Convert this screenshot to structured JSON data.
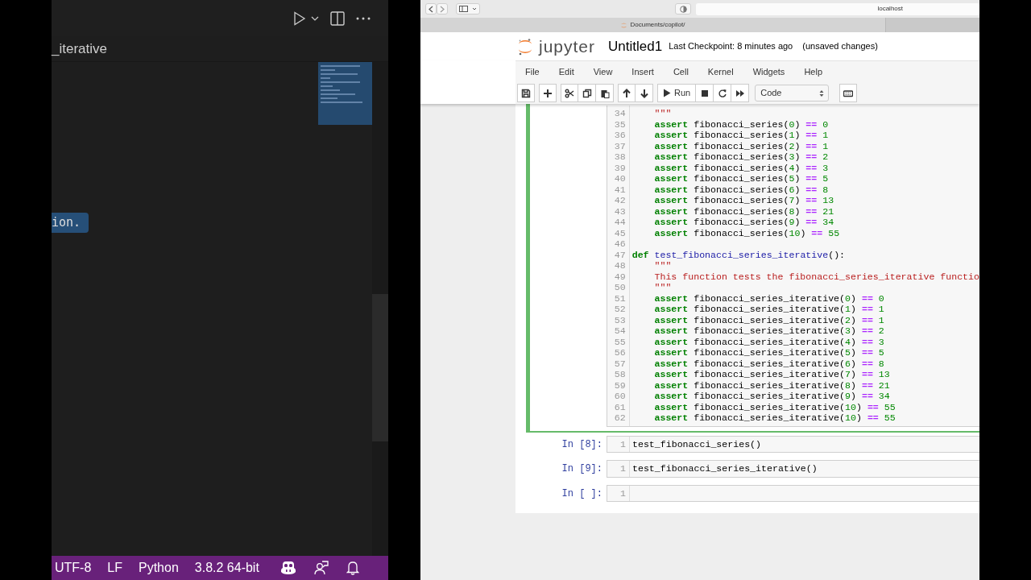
{
  "vscode": {
    "breadcrumb": "_iterative",
    "highlight": "ion.",
    "status_bar": [
      "UTF-8",
      "LF",
      "Python",
      "3.8.2 64-bit"
    ]
  },
  "browser": {
    "address": "localhost",
    "tab": "Documents/copilot/"
  },
  "jupyter": {
    "logo_text": "jupyter",
    "title": "Untitled1",
    "checkpoint": "Last Checkpoint: 8 minutes ago",
    "save_state": "(unsaved changes)",
    "menu": [
      "File",
      "Edit",
      "View",
      "Insert",
      "Cell",
      "Kernel",
      "Widgets",
      "Help"
    ],
    "toolbar": {
      "run_label": "Run",
      "cell_type": "Code"
    },
    "cells": [
      {
        "selected": true,
        "lines": [
          {
            "n": "34",
            "indent": true,
            "tokens": [
              {
                "kind": "string",
                "text": "\"\"\""
              }
            ]
          },
          {
            "n": "35",
            "indent": true,
            "tokens": [
              {
                "kind": "keyword",
                "text": "assert"
              },
              {
                "kind": "plain",
                "text": " fibonacci_series("
              },
              {
                "kind": "number",
                "text": "0"
              },
              {
                "kind": "plain",
                "text": ") "
              },
              {
                "kind": "operator",
                "text": "=="
              },
              {
                "kind": "number",
                "text": " 0"
              }
            ]
          },
          {
            "n": "36",
            "indent": true,
            "tokens": [
              {
                "kind": "keyword",
                "text": "assert"
              },
              {
                "kind": "plain",
                "text": " fibonacci_series("
              },
              {
                "kind": "number",
                "text": "1"
              },
              {
                "kind": "plain",
                "text": ") "
              },
              {
                "kind": "operator",
                "text": "=="
              },
              {
                "kind": "number",
                "text": " 1"
              }
            ]
          },
          {
            "n": "37",
            "indent": true,
            "tokens": [
              {
                "kind": "keyword",
                "text": "assert"
              },
              {
                "kind": "plain",
                "text": " fibonacci_series("
              },
              {
                "kind": "number",
                "text": "2"
              },
              {
                "kind": "plain",
                "text": ") "
              },
              {
                "kind": "operator",
                "text": "=="
              },
              {
                "kind": "number",
                "text": " 1"
              }
            ]
          },
          {
            "n": "38",
            "indent": true,
            "tokens": [
              {
                "kind": "keyword",
                "text": "assert"
              },
              {
                "kind": "plain",
                "text": " fibonacci_series("
              },
              {
                "kind": "number",
                "text": "3"
              },
              {
                "kind": "plain",
                "text": ") "
              },
              {
                "kind": "operator",
                "text": "=="
              },
              {
                "kind": "number",
                "text": " 2"
              }
            ]
          },
          {
            "n": "39",
            "indent": true,
            "tokens": [
              {
                "kind": "keyword",
                "text": "assert"
              },
              {
                "kind": "plain",
                "text": " fibonacci_series("
              },
              {
                "kind": "number",
                "text": "4"
              },
              {
                "kind": "plain",
                "text": ") "
              },
              {
                "kind": "operator",
                "text": "=="
              },
              {
                "kind": "number",
                "text": " 3"
              }
            ]
          },
          {
            "n": "40",
            "indent": true,
            "tokens": [
              {
                "kind": "keyword",
                "text": "assert"
              },
              {
                "kind": "plain",
                "text": " fibonacci_series("
              },
              {
                "kind": "number",
                "text": "5"
              },
              {
                "kind": "plain",
                "text": ") "
              },
              {
                "kind": "operator",
                "text": "=="
              },
              {
                "kind": "number",
                "text": " 5"
              }
            ]
          },
          {
            "n": "41",
            "indent": true,
            "tokens": [
              {
                "kind": "keyword",
                "text": "assert"
              },
              {
                "kind": "plain",
                "text": " fibonacci_series("
              },
              {
                "kind": "number",
                "text": "6"
              },
              {
                "kind": "plain",
                "text": ") "
              },
              {
                "kind": "operator",
                "text": "=="
              },
              {
                "kind": "number",
                "text": " 8"
              }
            ]
          },
          {
            "n": "42",
            "indent": true,
            "tokens": [
              {
                "kind": "keyword",
                "text": "assert"
              },
              {
                "kind": "plain",
                "text": " fibonacci_series("
              },
              {
                "kind": "number",
                "text": "7"
              },
              {
                "kind": "plain",
                "text": ") "
              },
              {
                "kind": "operator",
                "text": "=="
              },
              {
                "kind": "number",
                "text": " 13"
              }
            ]
          },
          {
            "n": "43",
            "indent": true,
            "tokens": [
              {
                "kind": "keyword",
                "text": "assert"
              },
              {
                "kind": "plain",
                "text": " fibonacci_series("
              },
              {
                "kind": "number",
                "text": "8"
              },
              {
                "kind": "plain",
                "text": ") "
              },
              {
                "kind": "operator",
                "text": "=="
              },
              {
                "kind": "number",
                "text": " 21"
              }
            ]
          },
          {
            "n": "44",
            "indent": true,
            "tokens": [
              {
                "kind": "keyword",
                "text": "assert"
              },
              {
                "kind": "plain",
                "text": " fibonacci_series("
              },
              {
                "kind": "number",
                "text": "9"
              },
              {
                "kind": "plain",
                "text": ") "
              },
              {
                "kind": "operator",
                "text": "=="
              },
              {
                "kind": "number",
                "text": " 34"
              }
            ]
          },
          {
            "n": "45",
            "indent": true,
            "tokens": [
              {
                "kind": "keyword",
                "text": "assert"
              },
              {
                "kind": "plain",
                "text": " fibonacci_series("
              },
              {
                "kind": "number",
                "text": "10"
              },
              {
                "kind": "plain",
                "text": ") "
              },
              {
                "kind": "operator",
                "text": "=="
              },
              {
                "kind": "number",
                "text": " 55"
              }
            ]
          },
          {
            "n": "46"
          },
          {
            "n": "47",
            "indent": false,
            "tokens": [
              {
                "kind": "keyword",
                "text": "def"
              },
              {
                "kind": "function",
                "text": " test_fibonacci_series_iterative"
              },
              {
                "kind": "plain",
                "text": "():"
              }
            ]
          },
          {
            "n": "48",
            "indent": true,
            "tokens": [
              {
                "kind": "string",
                "text": "\"\"\""
              }
            ]
          },
          {
            "n": "49",
            "indent": true,
            "tokens": [
              {
                "kind": "string",
                "text": "This function tests the fibonacci_series_iterative functio"
              }
            ]
          },
          {
            "n": "50",
            "indent": true,
            "tokens": [
              {
                "kind": "string",
                "text": "\"\"\""
              }
            ]
          },
          {
            "n": "51",
            "indent": true,
            "tokens": [
              {
                "kind": "keyword",
                "text": "assert"
              },
              {
                "kind": "plain",
                "text": " fibonacci_series_iterative("
              },
              {
                "kind": "number",
                "text": "0"
              },
              {
                "kind": "plain",
                "text": ") "
              },
              {
                "kind": "operator",
                "text": "=="
              },
              {
                "kind": "number",
                "text": " 0"
              }
            ]
          },
          {
            "n": "52",
            "indent": true,
            "tokens": [
              {
                "kind": "keyword",
                "text": "assert"
              },
              {
                "kind": "plain",
                "text": " fibonacci_series_iterative("
              },
              {
                "kind": "number",
                "text": "1"
              },
              {
                "kind": "plain",
                "text": ") "
              },
              {
                "kind": "operator",
                "text": "=="
              },
              {
                "kind": "number",
                "text": " 1"
              }
            ]
          },
          {
            "n": "53",
            "indent": true,
            "tokens": [
              {
                "kind": "keyword",
                "text": "assert"
              },
              {
                "kind": "plain",
                "text": " fibonacci_series_iterative("
              },
              {
                "kind": "number",
                "text": "2"
              },
              {
                "kind": "plain",
                "text": ") "
              },
              {
                "kind": "operator",
                "text": "=="
              },
              {
                "kind": "number",
                "text": " 1"
              }
            ]
          },
          {
            "n": "54",
            "indent": true,
            "tokens": [
              {
                "kind": "keyword",
                "text": "assert"
              },
              {
                "kind": "plain",
                "text": " fibonacci_series_iterative("
              },
              {
                "kind": "number",
                "text": "3"
              },
              {
                "kind": "plain",
                "text": ") "
              },
              {
                "kind": "operator",
                "text": "=="
              },
              {
                "kind": "number",
                "text": " 2"
              }
            ]
          },
          {
            "n": "55",
            "indent": true,
            "tokens": [
              {
                "kind": "keyword",
                "text": "assert"
              },
              {
                "kind": "plain",
                "text": " fibonacci_series_iterative("
              },
              {
                "kind": "number",
                "text": "4"
              },
              {
                "kind": "plain",
                "text": ") "
              },
              {
                "kind": "operator",
                "text": "=="
              },
              {
                "kind": "number",
                "text": " 3"
              }
            ]
          },
          {
            "n": "56",
            "indent": true,
            "tokens": [
              {
                "kind": "keyword",
                "text": "assert"
              },
              {
                "kind": "plain",
                "text": " fibonacci_series_iterative("
              },
              {
                "kind": "number",
                "text": "5"
              },
              {
                "kind": "plain",
                "text": ") "
              },
              {
                "kind": "operator",
                "text": "=="
              },
              {
                "kind": "number",
                "text": " 5"
              }
            ]
          },
          {
            "n": "57",
            "indent": true,
            "tokens": [
              {
                "kind": "keyword",
                "text": "assert"
              },
              {
                "kind": "plain",
                "text": " fibonacci_series_iterative("
              },
              {
                "kind": "number",
                "text": "6"
              },
              {
                "kind": "plain",
                "text": ") "
              },
              {
                "kind": "operator",
                "text": "=="
              },
              {
                "kind": "number",
                "text": " 8"
              }
            ]
          },
          {
            "n": "58",
            "indent": true,
            "tokens": [
              {
                "kind": "keyword",
                "text": "assert"
              },
              {
                "kind": "plain",
                "text": " fibonacci_series_iterative("
              },
              {
                "kind": "number",
                "text": "7"
              },
              {
                "kind": "plain",
                "text": ") "
              },
              {
                "kind": "operator",
                "text": "=="
              },
              {
                "kind": "number",
                "text": " 13"
              }
            ]
          },
          {
            "n": "59",
            "indent": true,
            "tokens": [
              {
                "kind": "keyword",
                "text": "assert"
              },
              {
                "kind": "plain",
                "text": " fibonacci_series_iterative("
              },
              {
                "kind": "number",
                "text": "8"
              },
              {
                "kind": "plain",
                "text": ") "
              },
              {
                "kind": "operator",
                "text": "=="
              },
              {
                "kind": "number",
                "text": " 21"
              }
            ]
          },
          {
            "n": "60",
            "indent": true,
            "tokens": [
              {
                "kind": "keyword",
                "text": "assert"
              },
              {
                "kind": "plain",
                "text": " fibonacci_series_iterative("
              },
              {
                "kind": "number",
                "text": "9"
              },
              {
                "kind": "plain",
                "text": ") "
              },
              {
                "kind": "operator",
                "text": "=="
              },
              {
                "kind": "number",
                "text": " 34"
              }
            ]
          },
          {
            "n": "61",
            "indent": true,
            "tokens": [
              {
                "kind": "keyword",
                "text": "assert"
              },
              {
                "kind": "plain",
                "text": " fibonacci_series_iterative("
              },
              {
                "kind": "number",
                "text": "10"
              },
              {
                "kind": "plain",
                "text": ") "
              },
              {
                "kind": "operator",
                "text": "=="
              },
              {
                "kind": "number",
                "text": " 55"
              }
            ]
          },
          {
            "n": "62",
            "indent": true,
            "tokens": [
              {
                "kind": "keyword",
                "text": "assert"
              },
              {
                "kind": "plain",
                "text": " fibonacci_series_iterative("
              },
              {
                "kind": "number",
                "text": "10"
              },
              {
                "kind": "plain",
                "text": ") "
              },
              {
                "kind": "operator",
                "text": "=="
              },
              {
                "kind": "number",
                "text": " 55"
              }
            ]
          }
        ]
      },
      {
        "selected": false,
        "prompt": "In [8]:",
        "lines": [
          {
            "n": "1",
            "indent": false,
            "tokens": [
              {
                "kind": "plain",
                "text": "test_fibonacci_series()"
              }
            ]
          }
        ]
      },
      {
        "selected": false,
        "prompt": "In [9]:",
        "lines": [
          {
            "n": "1",
            "indent": false,
            "tokens": [
              {
                "kind": "plain",
                "text": "test_fibonacci_series_iterative()"
              }
            ]
          }
        ]
      },
      {
        "selected": false,
        "prompt": "In [ ]:",
        "lines": [
          {
            "n": "1"
          }
        ]
      }
    ]
  }
}
